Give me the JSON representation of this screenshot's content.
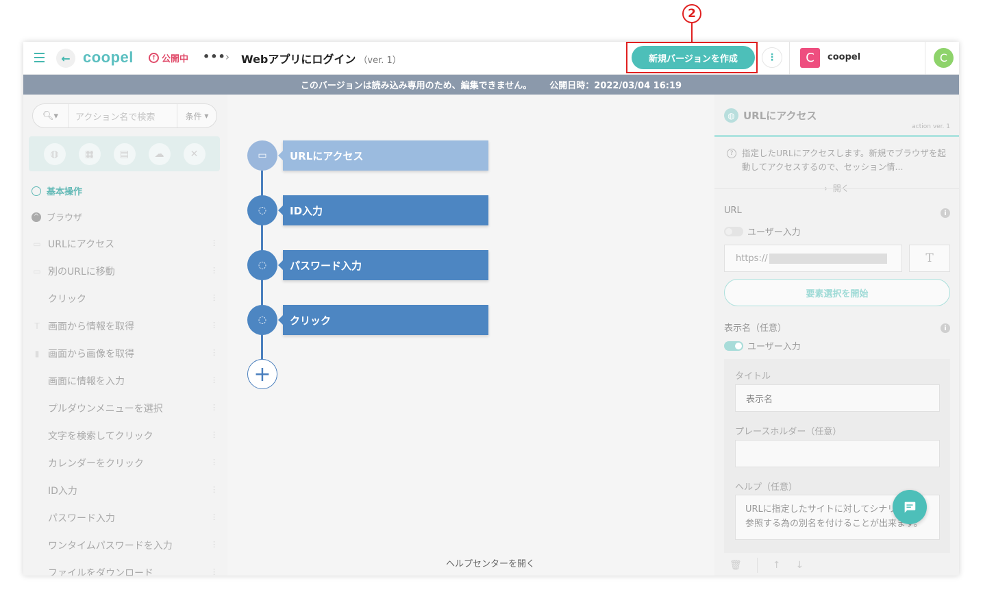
{
  "annotation": {
    "number": "2"
  },
  "header": {
    "logo": "coopel",
    "status": "公開中",
    "more": "•••",
    "title": "Webアプリにログイン",
    "version": "（ver. 1）",
    "new_version_button": "新規バージョンを作成",
    "org_initial": "C",
    "org_name": "coopel",
    "user_initial": "C"
  },
  "banner": {
    "readonly": "このバージョンは読み込み専用のため、編集できません。",
    "published": "公開日時：2022/03/04 16:19"
  },
  "sidebar": {
    "search_placeholder": "アクション名で検索",
    "condition": "条件",
    "section_basic": "基本操作",
    "section_browser": "ブラウザ",
    "items": [
      {
        "label": "URLにアクセス"
      },
      {
        "label": "別のURLに移動"
      },
      {
        "label": "クリック"
      },
      {
        "label": "画面から情報を取得"
      },
      {
        "label": "画面から画像を取得"
      },
      {
        "label": "画面に情報を入力"
      },
      {
        "label": "プルダウンメニューを選択"
      },
      {
        "label": "文字を検索してクリック"
      },
      {
        "label": "カレンダーをクリック"
      },
      {
        "label": "ID入力"
      },
      {
        "label": "パスワード入力"
      },
      {
        "label": "ワンタイムパスワードを入力"
      },
      {
        "label": "ファイルをダウンロード"
      }
    ]
  },
  "flow": {
    "nodes": [
      {
        "label": "URLにアクセス"
      },
      {
        "label": "ID入力"
      },
      {
        "label": "パスワード入力"
      },
      {
        "label": "クリック"
      }
    ],
    "help_link": "ヘルプセンターを開く"
  },
  "panel": {
    "title": "URLにアクセス",
    "action_version": "action ver. 1",
    "description": "指定したURLにアクセスします。新規でブラウザを起動してアクセスするので、セッション情...",
    "open": "開く",
    "url_label": "URL",
    "user_input_1": "ユーザー入力",
    "url_value": "https://",
    "t_button": "T",
    "select_button": "要素選択を開始",
    "display_name_label": "表示名（任意）",
    "user_input_2": "ユーザー入力",
    "title_label": "タイトル",
    "title_value": "表示名",
    "placeholder_label": "プレースホルダー（任意）",
    "placeholder_value": "",
    "help_label": "ヘルプ（任意）",
    "help_value": "URLに指定したサイトに対してシナリオ内で参照する為の別名を付けることが出来ます。"
  }
}
